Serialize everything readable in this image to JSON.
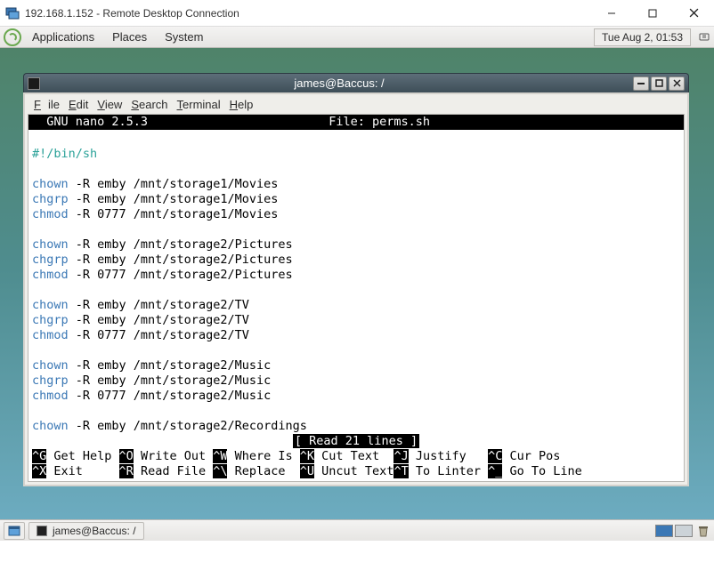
{
  "windows_titlebar": {
    "title": "192.168.1.152 - Remote Desktop Connection"
  },
  "gnome_panel": {
    "menus": {
      "applications": "Applications",
      "places": "Places",
      "system": "System"
    },
    "clock": "Tue Aug  2, 01:53"
  },
  "terminal_window": {
    "title": "james@Baccus: /",
    "menubar": {
      "file": "File",
      "edit": "Edit",
      "view": "View",
      "search": "Search",
      "terminal": "Terminal",
      "help": "Help"
    },
    "nano": {
      "header_left": "  GNU nano 2.5.3",
      "header_right": "File: perms.sh",
      "status": "[ Read 21 lines ]",
      "lines": [
        {
          "type": "shebang",
          "text": "#!/bin/sh"
        },
        {
          "type": "blank",
          "text": ""
        },
        {
          "type": "cmd",
          "cmd": "chown",
          "rest": " -R emby /mnt/storage1/Movies"
        },
        {
          "type": "cmd",
          "cmd": "chgrp",
          "rest": " -R emby /mnt/storage1/Movies"
        },
        {
          "type": "cmd",
          "cmd": "chmod",
          "rest": " -R 0777 /mnt/storage1/Movies"
        },
        {
          "type": "blank",
          "text": ""
        },
        {
          "type": "cmd",
          "cmd": "chown",
          "rest": " -R emby /mnt/storage2/Pictures"
        },
        {
          "type": "cmd",
          "cmd": "chgrp",
          "rest": " -R emby /mnt/storage2/Pictures"
        },
        {
          "type": "cmd",
          "cmd": "chmod",
          "rest": " -R 0777 /mnt/storage2/Pictures"
        },
        {
          "type": "blank",
          "text": ""
        },
        {
          "type": "cmd",
          "cmd": "chown",
          "rest": " -R emby /mnt/storage2/TV"
        },
        {
          "type": "cmd",
          "cmd": "chgrp",
          "rest": " -R emby /mnt/storage2/TV"
        },
        {
          "type": "cmd",
          "cmd": "chmod",
          "rest": " -R 0777 /mnt/storage2/TV"
        },
        {
          "type": "blank",
          "text": ""
        },
        {
          "type": "cmd",
          "cmd": "chown",
          "rest": " -R emby /mnt/storage2/Music"
        },
        {
          "type": "cmd",
          "cmd": "chgrp",
          "rest": " -R emby /mnt/storage2/Music"
        },
        {
          "type": "cmd",
          "cmd": "chmod",
          "rest": " -R 0777 /mnt/storage2/Music"
        },
        {
          "type": "blank",
          "text": ""
        },
        {
          "type": "cmd",
          "cmd": "chown",
          "rest": " -R emby /mnt/storage2/Recordings"
        }
      ],
      "shortcuts": {
        "row1": [
          {
            "key": "^G",
            "label": "Get Help"
          },
          {
            "key": "^O",
            "label": "Write Out"
          },
          {
            "key": "^W",
            "label": "Where Is"
          },
          {
            "key": "^K",
            "label": "Cut Text"
          },
          {
            "key": "^J",
            "label": "Justify"
          },
          {
            "key": "^C",
            "label": "Cur Pos"
          }
        ],
        "row2": [
          {
            "key": "^X",
            "label": "Exit"
          },
          {
            "key": "^R",
            "label": "Read File"
          },
          {
            "key": "^\\",
            "label": "Replace"
          },
          {
            "key": "^U",
            "label": "Uncut Text"
          },
          {
            "key": "^T",
            "label": "To Linter"
          },
          {
            "key": "^_",
            "label": "Go To Line"
          }
        ]
      }
    }
  },
  "taskbar": {
    "item_label": "james@Baccus: /"
  }
}
